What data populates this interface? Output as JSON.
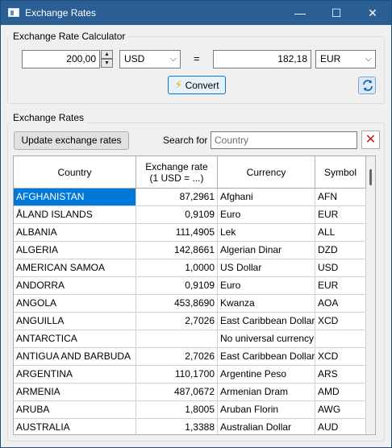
{
  "window": {
    "title": "Exchange Rates"
  },
  "calculator": {
    "group_label": "Exchange Rate Calculator",
    "amount": "200,00",
    "from_currency": "USD",
    "equals": "=",
    "result": "182,18",
    "to_currency": "EUR",
    "convert_label": "Convert"
  },
  "rates": {
    "group_label": "Exchange Rates",
    "update_label": "Update exchange rates",
    "search_label": "Search for",
    "search_placeholder": "Country",
    "columns": [
      "Country",
      "Exchange rate",
      "(1 USD = ...)",
      "Currency",
      "Symbol"
    ],
    "rows": [
      {
        "country": "AFGHANISTAN",
        "rate": "87,2961",
        "currency": "Afghani",
        "symbol": "AFN"
      },
      {
        "country": "ÅLAND ISLANDS",
        "rate": "0,9109",
        "currency": "Euro",
        "symbol": "EUR"
      },
      {
        "country": "ALBANIA",
        "rate": "111,4905",
        "currency": "Lek",
        "symbol": "ALL"
      },
      {
        "country": "ALGERIA",
        "rate": "142,8661",
        "currency": "Algerian Dinar",
        "symbol": "DZD"
      },
      {
        "country": "AMERICAN SAMOA",
        "rate": "1,0000",
        "currency": "US Dollar",
        "symbol": "USD"
      },
      {
        "country": "ANDORRA",
        "rate": "0,9109",
        "currency": "Euro",
        "symbol": "EUR"
      },
      {
        "country": "ANGOLA",
        "rate": "453,8690",
        "currency": "Kwanza",
        "symbol": "AOA"
      },
      {
        "country": "ANGUILLA",
        "rate": "2,7026",
        "currency": "East Caribbean Dollar",
        "symbol": "XCD"
      },
      {
        "country": "ANTARCTICA",
        "rate": "",
        "currency": "No universal currency",
        "symbol": ""
      },
      {
        "country": "ANTIGUA AND BARBUDA",
        "rate": "2,7026",
        "currency": "East Caribbean Dollar",
        "symbol": "XCD"
      },
      {
        "country": "ARGENTINA",
        "rate": "110,1700",
        "currency": "Argentine Peso",
        "symbol": "ARS"
      },
      {
        "country": "ARMENIA",
        "rate": "487,0672",
        "currency": "Armenian Dram",
        "symbol": "AMD"
      },
      {
        "country": "ARUBA",
        "rate": "1,8005",
        "currency": "Aruban Florin",
        "symbol": "AWG"
      },
      {
        "country": "AUSTRALIA",
        "rate": "1,3388",
        "currency": "Australian Dollar",
        "symbol": "AUD"
      }
    ]
  },
  "colors": {
    "titlebar": "#2b5e93",
    "selection": "#0078d7",
    "clear_icon": "#d11a1a"
  }
}
